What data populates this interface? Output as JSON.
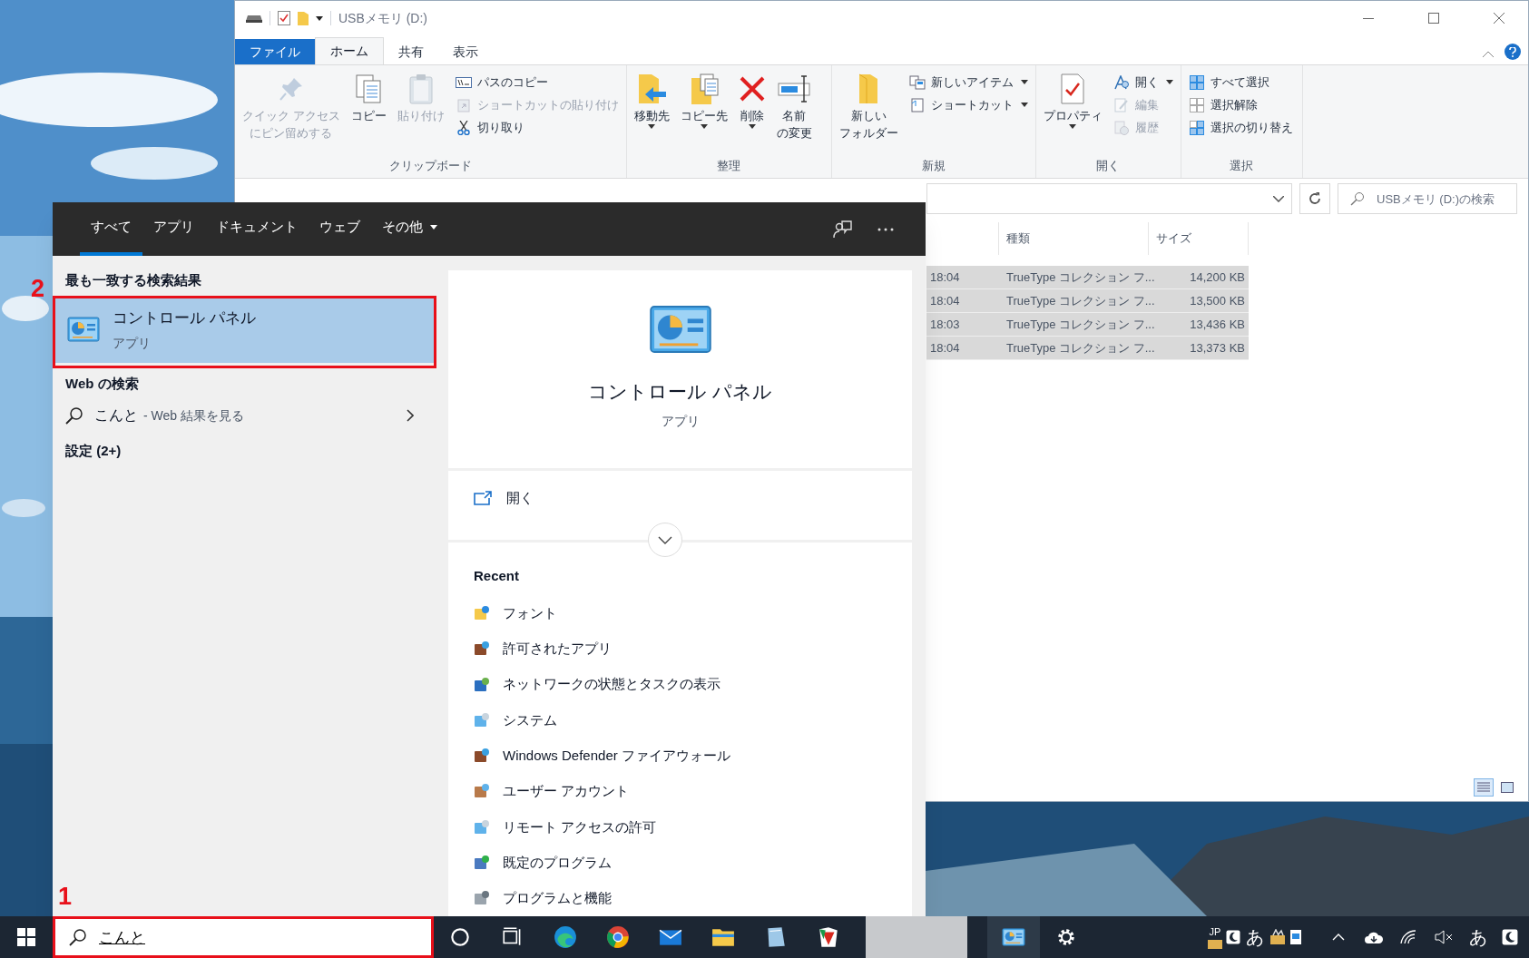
{
  "explorer": {
    "title": "USBメモリ (D:)",
    "tabs": [
      {
        "label": "ファイル",
        "kind": "file",
        "selected": false
      },
      {
        "label": "ホーム",
        "kind": "tab",
        "selected": true
      },
      {
        "label": "共有",
        "kind": "tab",
        "selected": false
      },
      {
        "label": "表示",
        "kind": "tab",
        "selected": false
      }
    ],
    "ribbon": [
      {
        "label": "クリップボード",
        "items": [
          {
            "lines": [
              "クイック アクセス",
              "にピン留めする"
            ],
            "kind": "large",
            "disabled": true,
            "dropdown": false
          },
          {
            "lines": [
              "コピー"
            ],
            "kind": "large",
            "disabled": false,
            "dropdown": false
          },
          {
            "lines": [
              "貼り付け"
            ],
            "kind": "large",
            "disabled": true,
            "dropdown": false
          },
          {
            "label": "パスのコピー",
            "kind": "small",
            "disabled": false,
            "dropdown": false
          },
          {
            "label": "ショートカットの貼り付け",
            "kind": "small",
            "disabled": true,
            "dropdown": false
          },
          {
            "label": "切り取り",
            "kind": "small",
            "disabled": false,
            "dropdown": false
          }
        ]
      },
      {
        "label": "整理",
        "items": [
          {
            "lines": [
              "移動先"
            ],
            "kind": "large",
            "disabled": false,
            "dropdown": true
          },
          {
            "lines": [
              "コピー先"
            ],
            "kind": "large",
            "disabled": false,
            "dropdown": true
          },
          {
            "lines": [
              "削除"
            ],
            "kind": "large",
            "disabled": false,
            "dropdown": true
          },
          {
            "lines": [
              "名前",
              "の変更"
            ],
            "kind": "large",
            "disabled": false,
            "dropdown": false
          }
        ]
      },
      {
        "label": "新規",
        "items": [
          {
            "lines": [
              "新しい",
              "フォルダー"
            ],
            "kind": "large",
            "disabled": false,
            "dropdown": false
          },
          {
            "label": "新しいアイテム",
            "kind": "small",
            "disabled": false,
            "dropdown": true
          },
          {
            "label": "ショートカット",
            "kind": "small",
            "disabled": false,
            "dropdown": true
          }
        ]
      },
      {
        "label": "開く",
        "items": [
          {
            "lines": [
              "プロパティ"
            ],
            "kind": "large",
            "disabled": false,
            "dropdown": true
          },
          {
            "label": "開く",
            "kind": "small",
            "disabled": false,
            "dropdown": true
          },
          {
            "label": "編集",
            "kind": "small",
            "disabled": true,
            "dropdown": false
          },
          {
            "label": "履歴",
            "kind": "small",
            "disabled": true,
            "dropdown": false
          }
        ]
      },
      {
        "label": "選択",
        "items": [
          {
            "label": "すべて選択",
            "kind": "small",
            "disabled": false,
            "dropdown": false
          },
          {
            "label": "選択解除",
            "kind": "small",
            "disabled": false,
            "dropdown": false
          },
          {
            "label": "選択の切り替え",
            "kind": "small",
            "disabled": false,
            "dropdown": false
          }
        ]
      }
    ],
    "search_placeholder": "USBメモリ (D:)の検索",
    "columns": [
      "種類",
      "サイズ"
    ],
    "rows": [
      {
        "column_1": "18:04",
        "type": "TrueType コレクション フ...",
        "size": "14,200 KB",
        "selected": true
      },
      {
        "column_1": "18:04",
        "type": "TrueType コレクション フ...",
        "size": "13,500 KB",
        "selected": true
      },
      {
        "column_1": "18:03",
        "type": "TrueType コレクション フ...",
        "size": "13,436 KB",
        "selected": true
      },
      {
        "column_1": "18:04",
        "type": "TrueType コレクション フ...",
        "size": "13,373 KB",
        "selected": true
      }
    ]
  },
  "search": {
    "tabs": [
      {
        "label": "すべて",
        "selected": true,
        "dropdown": false
      },
      {
        "label": "アプリ",
        "selected": false,
        "dropdown": false
      },
      {
        "label": "ドキュメント",
        "selected": false,
        "dropdown": false
      },
      {
        "label": "ウェブ",
        "selected": false,
        "dropdown": false
      },
      {
        "label": "その他",
        "selected": false,
        "dropdown": true
      }
    ],
    "best_match_heading": "最も一致する検索結果",
    "best_match": {
      "title": "コントロール パネル",
      "subtitle": "アプリ",
      "selected": true
    },
    "web_heading": "Web の検索",
    "web_item": {
      "query": "こんと",
      "suffix": "- Web 結果を見る"
    },
    "settings_heading": "設定 (2+)",
    "preview": {
      "title": "コントロール パネル",
      "subtitle": "アプリ",
      "open": "開く",
      "recent_heading": "Recent",
      "recent": [
        "フォント",
        "許可されたアプリ",
        "ネットワークの状態とタスクの表示",
        "システム",
        "Windows Defender ファイアウォール",
        "ユーザー アカウント",
        "リモート アクセスの許可",
        "既定のプログラム",
        "プログラムと機能"
      ]
    }
  },
  "taskbar": {
    "search_value": "こんと",
    "language": "JP",
    "ime_mode": "あ",
    "ime_mode_tray": "あ"
  },
  "annotations": [
    {
      "label": "2"
    },
    {
      "label": "1"
    }
  ]
}
